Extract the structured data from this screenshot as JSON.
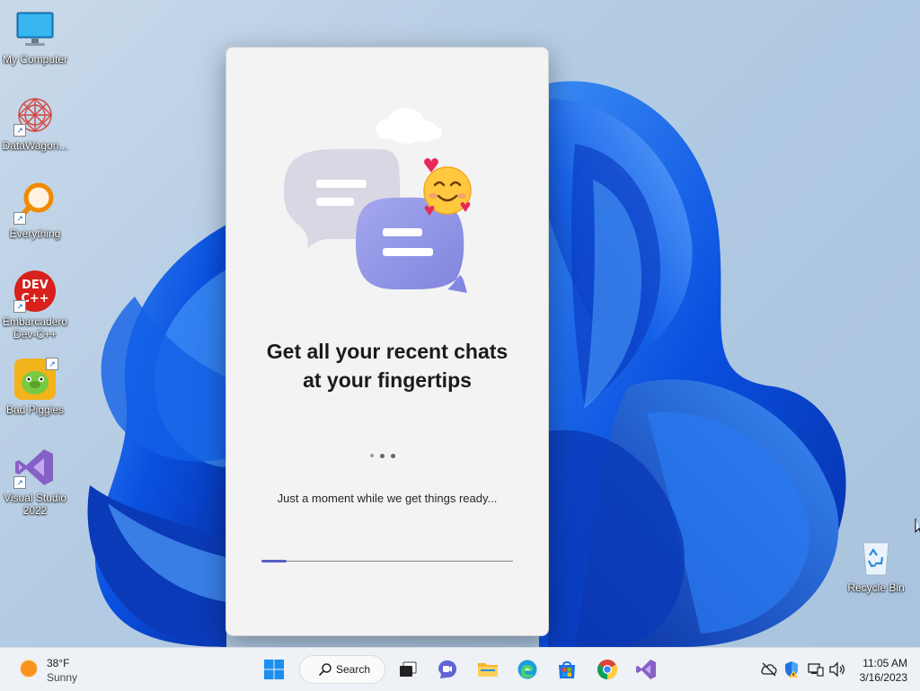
{
  "desktop": {
    "icons": [
      {
        "label": "My Computer"
      },
      {
        "label": "DataWagon..."
      },
      {
        "label": "Everything"
      },
      {
        "label": "Embarcadero Dev-C++"
      },
      {
        "label": "Bad Piggies"
      },
      {
        "label": "Visual Studio 2022"
      },
      {
        "label": "Recycle Bin"
      }
    ]
  },
  "splash": {
    "headline_line1": "Get all your recent chats",
    "headline_line2": "at your fingertips",
    "status": "Just a moment while we get things ready...",
    "progress": 0.1,
    "accent_color": "#5b5fc7"
  },
  "taskbar": {
    "weather": {
      "temp": "38°F",
      "condition": "Sunny",
      "icon": "sun-icon"
    },
    "search_label": "Search",
    "apps": [
      {
        "name": "start",
        "icon": "windows-logo-icon"
      },
      {
        "name": "search",
        "icon": "search-icon"
      },
      {
        "name": "task-view",
        "icon": "task-view-icon"
      },
      {
        "name": "teams-chat",
        "icon": "chat-icon"
      },
      {
        "name": "file-explorer",
        "icon": "folder-icon"
      },
      {
        "name": "edge",
        "icon": "edge-icon"
      },
      {
        "name": "store",
        "icon": "store-icon"
      },
      {
        "name": "chrome",
        "icon": "chrome-icon"
      },
      {
        "name": "visual-studio",
        "icon": "visual-studio-icon"
      }
    ],
    "tray": [
      "cloud-offline-icon",
      "security-icon",
      "network-icon",
      "volume-icon"
    ],
    "time": "11:05 AM",
    "date": "3/16/2023"
  }
}
